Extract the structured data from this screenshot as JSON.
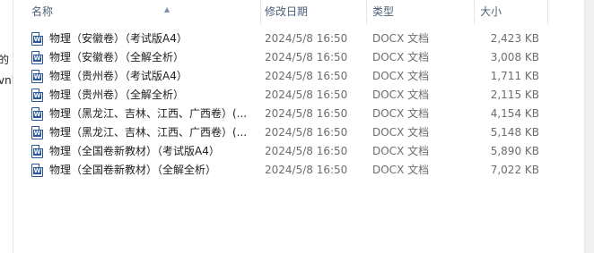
{
  "columns": {
    "name": "名称",
    "modified": "修改日期",
    "type": "类型",
    "size": "大小"
  },
  "left_pane": {
    "fragment_1": "的",
    "fragment_2": "vnl"
  },
  "files": [
    {
      "name": "物理（安徽卷）（考试版A4）",
      "modified": "2024/5/8 16:50",
      "type": "DOCX 文档",
      "size": "2,423 KB",
      "icon": "word-document-icon"
    },
    {
      "name": "物理（安徽卷）（全解全析）",
      "modified": "2024/5/8 16:50",
      "type": "DOCX 文档",
      "size": "3,008 KB",
      "icon": "word-document-icon"
    },
    {
      "name": "物理（贵州卷）（考试版A4）",
      "modified": "2024/5/8 16:50",
      "type": "DOCX 文档",
      "size": "1,711 KB",
      "icon": "word-document-icon"
    },
    {
      "name": "物理（贵州卷）（全解全析）",
      "modified": "2024/5/8 16:50",
      "type": "DOCX 文档",
      "size": "2,115 KB",
      "icon": "word-document-icon"
    },
    {
      "name": "物理（黑龙江、吉林、江西、广西卷）(...",
      "modified": "2024/5/8 16:50",
      "type": "DOCX 文档",
      "size": "4,154 KB",
      "icon": "word-document-icon"
    },
    {
      "name": "物理（黑龙江、吉林、江西、广西卷）(...",
      "modified": "2024/5/8 16:50",
      "type": "DOCX 文档",
      "size": "5,148 KB",
      "icon": "word-document-icon"
    },
    {
      "name": "物理（全国卷新教材）（考试版A4）",
      "modified": "2024/5/8 16:50",
      "type": "DOCX 文档",
      "size": "5,890 KB",
      "icon": "word-document-icon"
    },
    {
      "name": "物理（全国卷新教材）（全解全析）",
      "modified": "2024/5/8 16:50",
      "type": "DOCX 文档",
      "size": "7,022 KB",
      "icon": "word-document-icon"
    }
  ]
}
